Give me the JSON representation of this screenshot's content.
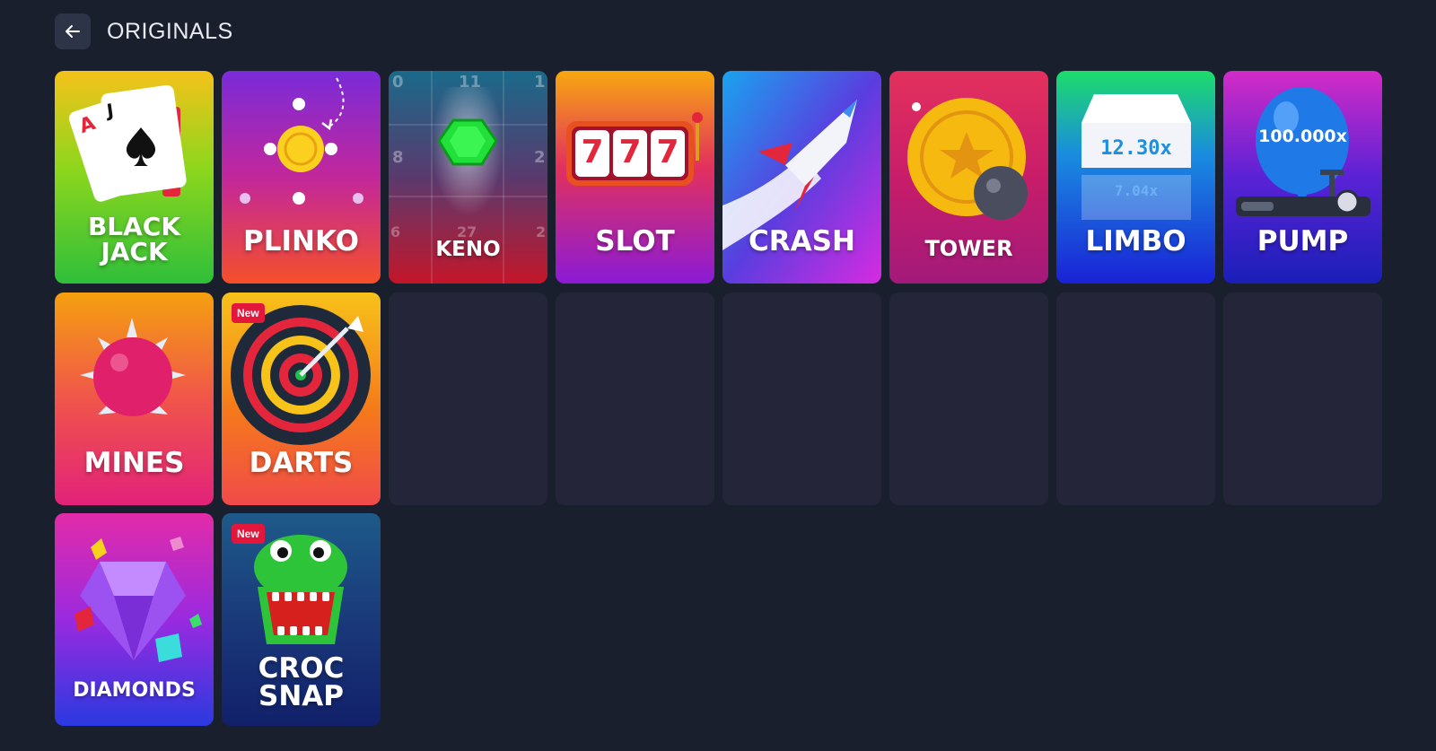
{
  "header": {
    "title": "ORIGINALS",
    "back_icon": "arrow-left-icon"
  },
  "games": [
    {
      "label": "BLACK\nJACK",
      "badge": null
    },
    {
      "label": "PLINKO",
      "badge": null
    },
    {
      "label": "KENO",
      "badge": null
    },
    {
      "label": "SLOT",
      "badge": null
    },
    {
      "label": "CRASH",
      "badge": null
    },
    {
      "label": "TOWER",
      "badge": null
    },
    {
      "label": "LIMBO",
      "badge": null,
      "multiplier_main": "12.30x",
      "multiplier_reflection": "7.04x"
    },
    {
      "label": "PUMP",
      "badge": null,
      "multiplier": "100.000x"
    },
    {
      "label": "MINES",
      "badge": null
    },
    {
      "label": "DARTS",
      "badge": "New"
    },
    {
      "label": "DIAMONDS",
      "badge": null
    },
    {
      "label": "CROC\nSNAP",
      "badge": "New"
    }
  ],
  "keno_numbers": [
    "0",
    "11",
    "1",
    "8",
    "2",
    "6",
    "27",
    "2"
  ],
  "slot_reels": [
    "7",
    "7",
    "7"
  ],
  "blackjack_cards": [
    "A",
    "J"
  ],
  "placeholder_count": 6
}
